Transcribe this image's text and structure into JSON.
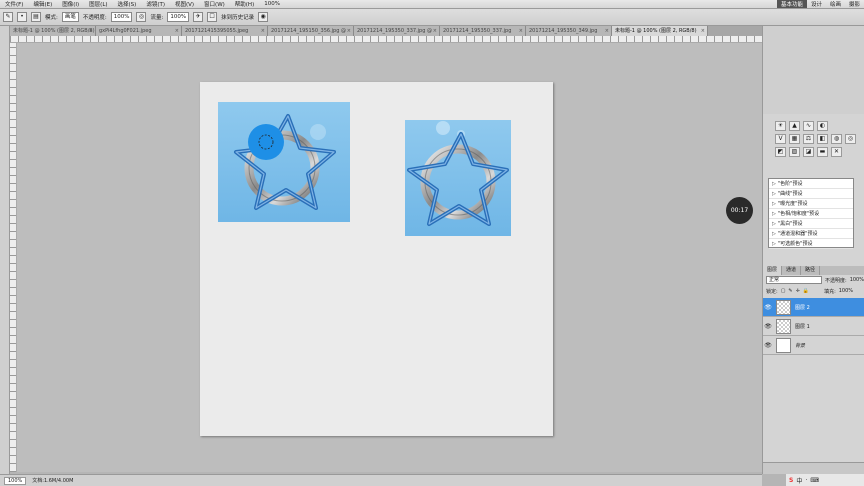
{
  "menubar": {
    "items": [
      "文件(F)",
      "编辑(E)",
      "图像(I)",
      "图层(L)",
      "选择(S)",
      "滤镜(T)",
      "视图(V)",
      "窗口(W)",
      "帮助(H)"
    ],
    "zoom": "100%",
    "workspaces": [
      "基本功能",
      "设计",
      "绘画",
      "摄影"
    ],
    "active_workspace": "基本功能"
  },
  "options_bar": {
    "mode_label": "模式:",
    "mode_value": "画笔",
    "opacity_label": "不透明度:",
    "opacity_value": "100%",
    "flow_label": "流量:",
    "flow_value": "100%",
    "history_label": "抹到历史记录"
  },
  "tabs": [
    {
      "label": "未标题-1 @ 100% (图层 2, RGB/8)",
      "active": false
    },
    {
      "label": "gxPi4Lfhg0F021.jpeg",
      "active": false
    },
    {
      "label": "2017121415395055.jpeg",
      "active": false
    },
    {
      "label": "20171214_195150_356.jpg @",
      "active": false
    },
    {
      "label": "20171214_195350_337.jpg @",
      "active": false
    },
    {
      "label": "20171214_195350_337.jpg",
      "active": false
    },
    {
      "label": "20171214_195350_349.jpg",
      "active": false
    },
    {
      "label": "未标题-1 @ 100% (图层 2, RGB/8)",
      "active": true
    }
  ],
  "status": {
    "zoom": "100%",
    "doc_info": "文档:1.6M/4.00M"
  },
  "timer": "00:17",
  "adjustments": {
    "presets": [
      "\"色阶\"预设",
      "\"曲线\"预设",
      "\"曝光度\"预设",
      "\"色相/饱和度\"预设",
      "\"黑白\"预设",
      "\"通道混和器\"预设",
      "\"可选颜色\"预设"
    ]
  },
  "layers_panel": {
    "tabs": [
      "图层",
      "通道",
      "路径"
    ],
    "blend_mode": "正常",
    "opacity_label": "不透明度:",
    "opacity_value": "100%",
    "lock_label": "锁定:",
    "fill_label": "填充:",
    "fill_value": "100%",
    "layers": [
      {
        "name": "图层 2",
        "selected": true
      },
      {
        "name": "图层 1",
        "selected": false
      },
      {
        "name": "背景",
        "selected": false
      }
    ]
  },
  "ime": {
    "label": "中"
  },
  "colors": {
    "selection": "#3e8ee0",
    "brush": "#1e8fe6",
    "sky": "#7ec0ea",
    "ring_blue": "#2a6fb8"
  }
}
